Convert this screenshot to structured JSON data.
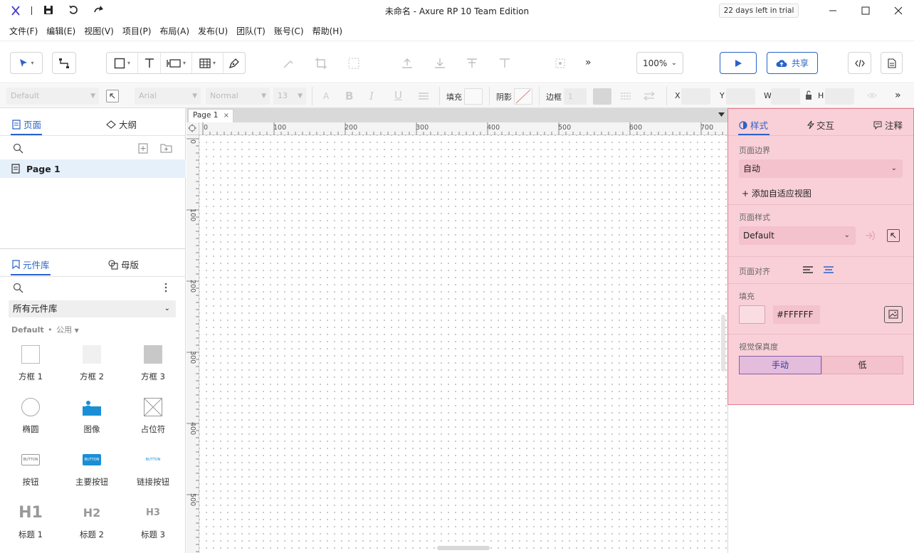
{
  "app": {
    "window_title": "未命名 - Axure RP 10 Team Edition",
    "trial_badge": "22 days left in trial"
  },
  "menu": [
    "文件(F)",
    "编辑(E)",
    "视图(V)",
    "项目(P)",
    "布局(A)",
    "发布(U)",
    "团队(T)",
    "账号(C)",
    "帮助(H)"
  ],
  "toolbar": {
    "zoom": "100%",
    "share_label": "共享",
    "overflow": "»"
  },
  "format_bar": {
    "style_select": "Default",
    "font_select": "Arial",
    "weight_select": "Normal",
    "size_select": "13",
    "fill_label": "填充",
    "shadow_label": "阴影",
    "border_label": "边框",
    "border_value": "1",
    "x_label": "X",
    "y_label": "Y",
    "w_label": "W",
    "h_label": "H"
  },
  "pages_panel": {
    "tab_pages": "页面",
    "tab_outline": "大纲",
    "pages": [
      "Page 1"
    ]
  },
  "library_panel": {
    "tab_libraries": "元件库",
    "tab_masters": "母版",
    "library_select": "所有元件库",
    "library_group": "Default",
    "library_subgroup": "公用",
    "widgets": [
      {
        "label": "方框 1",
        "icon": "box1-icon"
      },
      {
        "label": "方框 2",
        "icon": "box2-icon"
      },
      {
        "label": "方框 3",
        "icon": "box3-icon"
      },
      {
        "label": "椭圆",
        "icon": "ellipse-icon"
      },
      {
        "label": "图像",
        "icon": "image-icon"
      },
      {
        "label": "占位符",
        "icon": "placeholder-icon"
      },
      {
        "label": "按钮",
        "icon": "button-icon",
        "glyph": "BUTTON"
      },
      {
        "label": "主要按钮",
        "icon": "primary-button-icon",
        "glyph": "BUTTON"
      },
      {
        "label": "链接按钮",
        "icon": "link-button-icon",
        "glyph": "BUTTON"
      },
      {
        "label": "标题 1",
        "icon": "h1-icon",
        "glyph": "H1"
      },
      {
        "label": "标题 2",
        "icon": "h2-icon",
        "glyph": "H2"
      },
      {
        "label": "标题 3",
        "icon": "h3-icon",
        "glyph": "H3"
      }
    ]
  },
  "canvas": {
    "tab_name": "Page 1",
    "h_ruler": [
      "0",
      "100",
      "200",
      "300",
      "400",
      "500",
      "600",
      "700"
    ],
    "v_ruler": [
      "0",
      "100",
      "200",
      "300",
      "400",
      "500"
    ]
  },
  "inspector": {
    "tab_style": "样式",
    "tab_interactions": "交互",
    "tab_notes": "注释",
    "page_bounds_label": "页面边界",
    "page_bounds_value": "自动",
    "add_adaptive_view": "+ 添加自适应视图",
    "page_style_label": "页面样式",
    "page_style_value": "Default",
    "page_align_label": "页面对齐",
    "fill_label": "填充",
    "fill_hex": "#FFFFFF",
    "fidelity_label": "视觉保真度",
    "fidelity_manual": "手动",
    "fidelity_low": "低"
  },
  "colors": {
    "accent": "#2a62c9",
    "inspector_bg": "#f9d0d8",
    "primary_button": "#1a8fd6"
  }
}
